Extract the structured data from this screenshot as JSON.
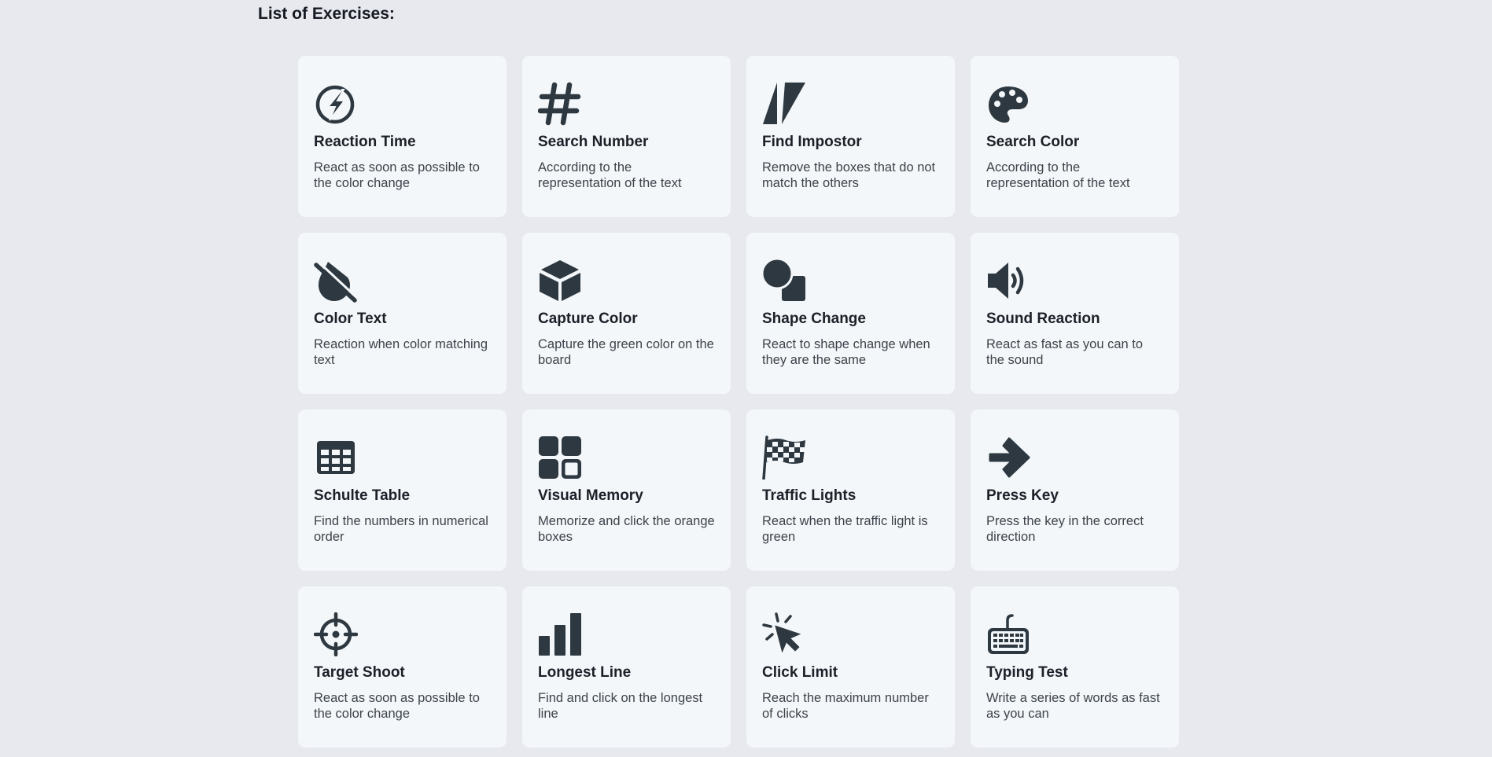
{
  "page": {
    "title": "List of Exercises:"
  },
  "colors": {
    "background": "#e8e8ef",
    "card": "#f3f7f9",
    "icon": "#2e3840"
  },
  "exercises": [
    {
      "title": "Reaction Time",
      "description": "React as soon as possible to the color change",
      "icon": "bolt-circle-icon"
    },
    {
      "title": "Search Number",
      "description": "According to the representation of the text",
      "icon": "hashtag-icon"
    },
    {
      "title": "Find Impostor",
      "description": "Remove the boxes that do not match the others",
      "icon": "impostor-triangles-icon"
    },
    {
      "title": "Search Color",
      "description": "According to the representation of the text",
      "icon": "palette-icon"
    },
    {
      "title": "Color Text",
      "description": "Reaction when color matching text",
      "icon": "tint-slash-icon"
    },
    {
      "title": "Capture Color",
      "description": "Capture the green color on the board",
      "icon": "cube-icon"
    },
    {
      "title": "Shape Change",
      "description": "React to shape change when they are the same",
      "icon": "shapes-icon"
    },
    {
      "title": "Sound Reaction",
      "description": "React as fast as you can to the sound",
      "icon": "volume-icon"
    },
    {
      "title": "Schulte Table",
      "description": "Find the numbers in numerical order",
      "icon": "table-icon"
    },
    {
      "title": "Visual Memory",
      "description": "Memorize and click the orange boxes",
      "icon": "grid-squares-icon"
    },
    {
      "title": "Traffic Lights",
      "description": "React when the traffic light is green",
      "icon": "checkered-flag-icon"
    },
    {
      "title": "Press Key",
      "description": "Press the key in the correct direction",
      "icon": "arrow-right-icon"
    },
    {
      "title": "Target Shoot",
      "description": "React as soon as possible to the color change",
      "icon": "crosshairs-icon"
    },
    {
      "title": "Longest Line",
      "description": "Find and click on the longest line",
      "icon": "signal-bars-icon"
    },
    {
      "title": "Click Limit",
      "description": "Reach the maximum number of clicks",
      "icon": "mouse-pointer-click-icon"
    },
    {
      "title": "Typing Test",
      "description": "Write a series of words as fast as you can",
      "icon": "keyboard-icon"
    }
  ]
}
